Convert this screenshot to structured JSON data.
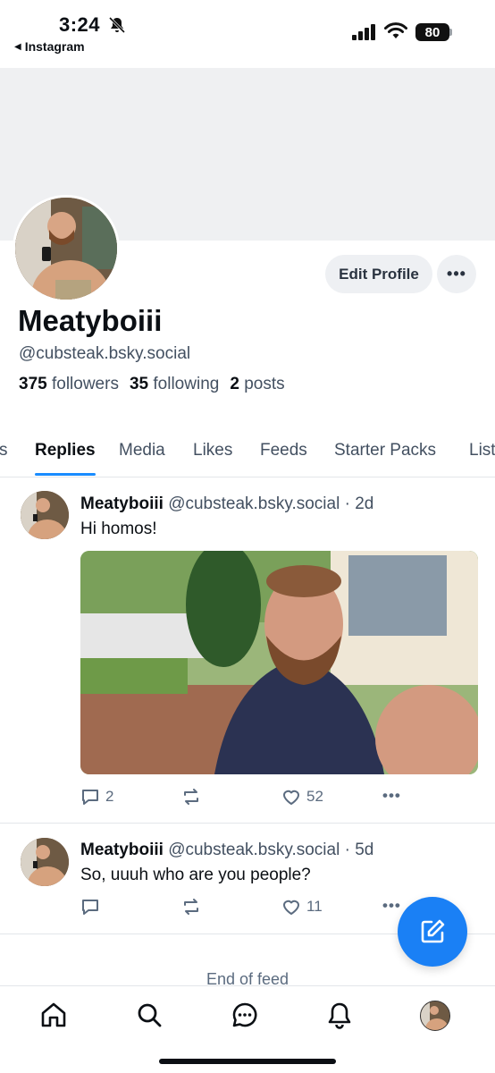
{
  "status_bar": {
    "time": "3:24",
    "back_app": "Instagram",
    "battery": "80"
  },
  "profile": {
    "display_name": "Meatyboiii",
    "handle": "@cubsteak.bsky.social",
    "followers_count": "375",
    "followers_label": "followers",
    "following_count": "35",
    "following_label": "following",
    "posts_count": "2",
    "posts_label": "posts",
    "edit_label": "Edit Profile",
    "more_label": "•••"
  },
  "tabs": [
    {
      "label": "Posts"
    },
    {
      "label": "Replies",
      "active": true
    },
    {
      "label": "Media"
    },
    {
      "label": "Likes"
    },
    {
      "label": "Feeds"
    },
    {
      "label": "Starter Packs"
    },
    {
      "label": "Lists"
    }
  ],
  "posts": [
    {
      "author": "Meatyboiii",
      "handle": "@cubsteak.bsky.social",
      "age": "· 2d",
      "text": "Hi homos!",
      "replies": "2",
      "reposts": "",
      "likes": "52"
    },
    {
      "author": "Meatyboiii",
      "handle": "@cubsteak.bsky.social",
      "age": "· 5d",
      "text": "So, uuuh who are you people?",
      "replies": "",
      "reposts": "",
      "likes": "11"
    }
  ],
  "end_of_feed": "End of feed",
  "colors": {
    "accent": "#1a80f5",
    "muted": "#435061",
    "banner": "#eff0f2"
  }
}
